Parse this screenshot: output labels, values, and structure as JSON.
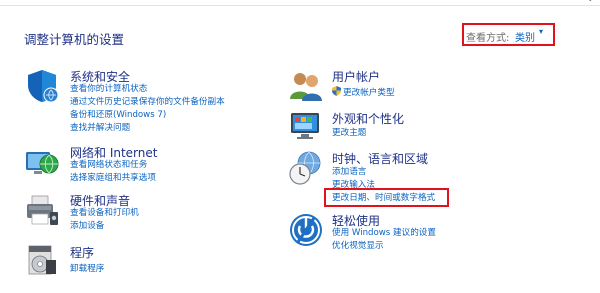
{
  "header": {
    "title": "调整计算机的设置",
    "view_by_label": "查看方式:",
    "view_by_value": "类别",
    "view_by_caret": "▾"
  },
  "left": [
    {
      "title": "系统和安全",
      "links": [
        "查看你的计算机状态",
        "通过文件历史记录保存你的文件备份副本",
        "备份和还原(Windows 7)",
        "查找并解决问题"
      ]
    },
    {
      "title": "网络和 Internet",
      "links": [
        "查看网络状态和任务",
        "选择家庭组和共享选项"
      ]
    },
    {
      "title": "硬件和声音",
      "links": [
        "查看设备和打印机",
        "添加设备"
      ]
    },
    {
      "title": "程序",
      "links": [
        "卸载程序"
      ]
    }
  ],
  "right": [
    {
      "title": "用户帐户",
      "links": [
        "更改帐户类型"
      ]
    },
    {
      "title": "外观和个性化",
      "links": [
        "更改主题"
      ]
    },
    {
      "title": "时钟、语言和区域",
      "links": [
        "添加语言",
        "更改输入法",
        "更改日期、时间或数字格式"
      ]
    },
    {
      "title": "轻松使用",
      "links": [
        "使用 Windows 建议的设置",
        "优化视觉显示"
      ]
    }
  ],
  "colors": {
    "title_text": "#1e3287",
    "link_text": "#0b63c1",
    "highlight_border": "#e0121c"
  }
}
